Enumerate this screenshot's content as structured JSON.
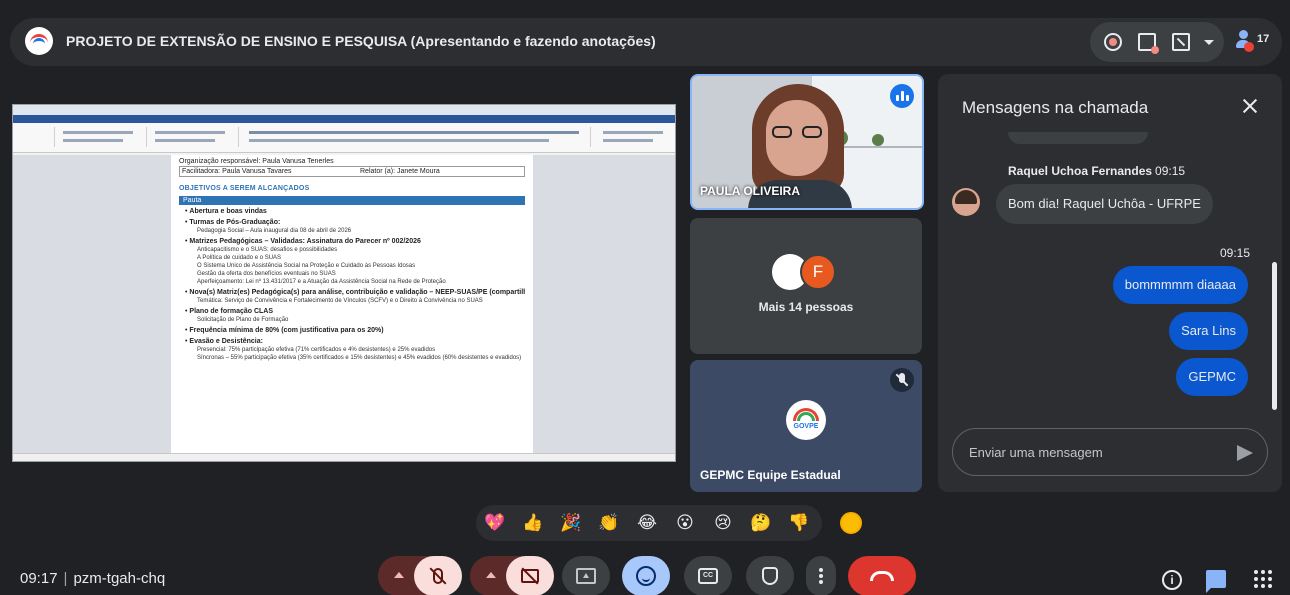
{
  "topbar": {
    "title": "PROJETO DE EXTENSÃO DE ENSINO E PESQUISA (Apresentando e fazendo anotações)",
    "participants_count": "17"
  },
  "shared_screen": {
    "doc_lines": [
      "Organização responsável: Paula Vanusa Tenerles"
    ],
    "table": {
      "facilitadora": "Facilitadora: Paula Vanusa Tavares",
      "relator": "Relator (a): Janete Moura"
    },
    "heading": "OBJETIVOS A SEREM ALCANÇADOS",
    "highlight": "Pauta",
    "items": [
      {
        "text": "Abertura e boas vindas",
        "subs": []
      },
      {
        "text": "Turmas de Pós-Graduação:",
        "subs": [
          "Pedagogia Social – Aula inaugural dia 08 de abril de 2026"
        ]
      },
      {
        "text": "Matrizes Pedagógicas – Validadas: Assinatura do Parecer nº 002/2026",
        "subs": [
          "Anticapacitismo e o SUAS: desafios e possibilidades",
          "A Política de cuidado e o SUAS",
          "O Sistema Único de Assistência Social na Proteção e Cuidado às Pessoas Idosas",
          "Gestão da oferta dos benefícios eventuais no SUAS",
          "Aperfeiçoamento: Lei nº 13.431/2017 e a Atuação da Assistência Social na Rede de Proteção"
        ]
      },
      {
        "text": "Nova(s) Matriz(es) Pedagógica(s) para análise, contribuição e validação – NEEP-SUAS/PE (compartilhamento via Drive)",
        "subs": [
          "Temática: Serviço de Convivência e Fortalecimento de Vínculos (SCFV) e o Direito à Convivência no SUAS"
        ]
      },
      {
        "text": "Plano de formação CLAS",
        "subs": [
          "Solicitação de Plano de Formação"
        ]
      },
      {
        "text": "Frequência mínima de 80% (com justificativa para os 20%)",
        "subs": []
      },
      {
        "text": "Evasão e Desistência:",
        "subs": [
          "Presencial: 75% participação efetiva (71% certificados e 4% desistentes) e 25% evadidos",
          "Síncronas – 55% participação efetiva (35% certificados e 15% desistentes) e 45% evadidos (60% desistentes e evadidos)"
        ]
      }
    ]
  },
  "tiles": {
    "video": {
      "name": "PAULA OLIVEIRA"
    },
    "more": {
      "avatar_letter": "F",
      "label": "Mais 14 pessoas"
    },
    "gepmc": {
      "logo_text": "GOVPE",
      "name": "GEPMC Equipe Estadual"
    }
  },
  "chat": {
    "title": "Mensagens na chamada",
    "incoming": {
      "sender": "Raquel Uchoa Fernandes",
      "time": "09:15",
      "text": "Bom dia! Raquel Uchôa - UFRPE"
    },
    "outgoing_time": "09:15",
    "outgoing": [
      "bommmmm diaaaa",
      "Sara Lins",
      "GEPMC"
    ],
    "input_placeholder": "Enviar uma mensagem"
  },
  "reactions": [
    "💖",
    "👍",
    "🎉",
    "👏",
    "😂",
    "😮",
    "😢",
    "🤔",
    "👎"
  ],
  "bottombar": {
    "time": "09:17",
    "meeting_code": "pzm-tgah-chq",
    "cc_label": "CC"
  },
  "colors": {
    "background": "#202124",
    "accent_blue": "#0b57d0",
    "end_call_red": "#dc362e"
  }
}
